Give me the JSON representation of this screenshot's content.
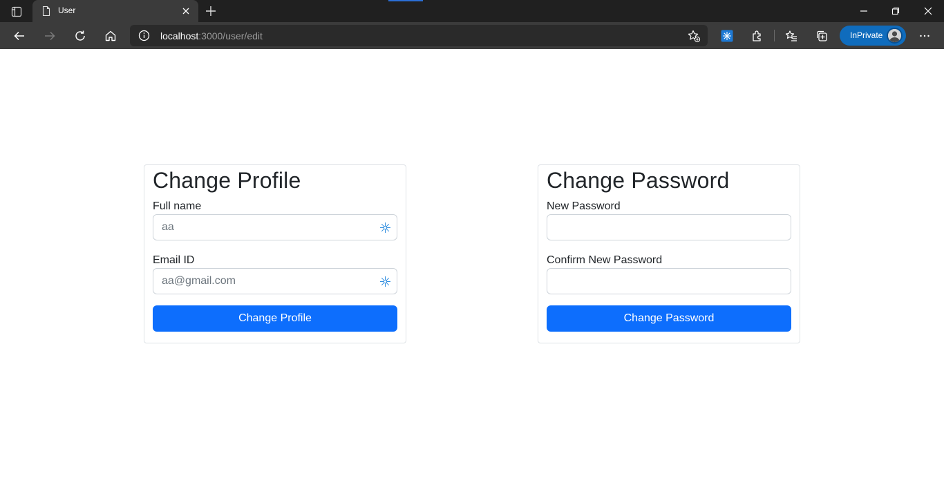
{
  "browser": {
    "tab_title": "User",
    "url_host": "localhost",
    "url_path": ":3000/user/edit",
    "inprivate_label": "InPrivate"
  },
  "profile": {
    "title": "Change Profile",
    "fullname_label": "Full name",
    "fullname_value": "aa",
    "email_label": "Email ID",
    "email_value": "aa@gmail.com",
    "button_label": "Change Profile"
  },
  "password": {
    "title": "Change Password",
    "new_label": "New Password",
    "new_value": "",
    "confirm_label": "Confirm New Password",
    "confirm_value": "",
    "button_label": "Change Password"
  },
  "colors": {
    "primary": "#0d6efd",
    "inprivate": "#0f6cbd",
    "chrome_dark": "#202020",
    "chrome_toolbar": "#3b3b3b"
  }
}
